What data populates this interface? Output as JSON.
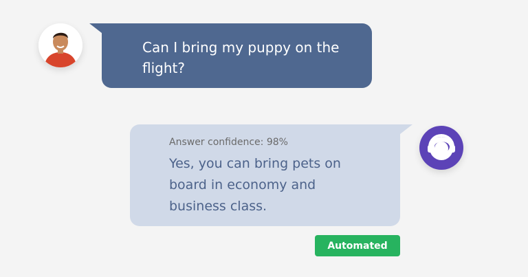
{
  "messages": {
    "user": {
      "text": "Can I bring my puppy on the flight?",
      "bubble_color": "#4f6890"
    },
    "bot": {
      "confidence_label": "Answer confidence: 98%",
      "text": "Yes, you can bring pets on board in economy and business class.",
      "bubble_color": "#d0d9e8"
    }
  },
  "badge": {
    "label": "Automated",
    "color": "#27b35f"
  },
  "icons": {
    "user_avatar": "user-photo-avatar",
    "bot_avatar": "headset-agent-icon",
    "bot_avatar_color": "#5c43b7"
  }
}
